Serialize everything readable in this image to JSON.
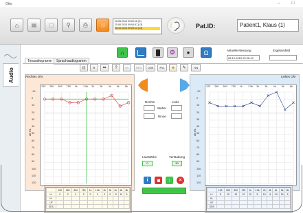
{
  "window": {
    "title": "Otto",
    "minimize": "–",
    "close": "□"
  },
  "sessions": [
    "25.06.2015 09:02:16 (S)",
    "25.06.2015 09:04:57 (13)",
    "08.10.2015 09:25:12 (13)"
  ],
  "patient": {
    "label": "Pat.ID:",
    "name": "Patient1, Klaus (1)"
  },
  "sidebar": {
    "audio": "Audio"
  },
  "tabs": [
    "Tonaudiogramm",
    "Sprachaudiogramm"
  ],
  "small_buttons": [
    "",
    "",
    "",
    "",
    "BC",
    "STG",
    "LGB",
    "PvL",
    "",
    "",
    "TIN"
  ],
  "measurement": {
    "aktuelle_label": "Aktuelle Messung",
    "aktuelle_value": "08.10.2015 09:25:12",
    "end_label": "Ergebnisfeld"
  },
  "right_ear": {
    "title": "Rechtes Ohr"
  },
  "left_ear": {
    "title": "Linkes Ohr"
  },
  "xaxis": [
    "125",
    "250",
    "500",
    "750",
    "1k",
    "1.5k",
    "2k",
    "3k",
    "4k",
    "6k",
    "8k"
  ],
  "yaxis": [
    "-10",
    "0",
    "10",
    "20",
    "30",
    "40",
    "50",
    "60",
    "70",
    "80",
    "90",
    "100",
    "110",
    "120"
  ],
  "ylabel": "dB HL",
  "center": {
    "rechts": "Rechts",
    "links": "Links",
    "weber": "Weber",
    "rinne": "Rinne",
    "lautstaerke": "Lautstärke",
    "lautstaerke_value": "0",
    "vertaeubung": "Vertäubung",
    "vertaeubung_value": "30"
  },
  "table_rows": [
    "LL",
    "KL",
    "UF",
    "SDS"
  ],
  "table_right_vals": [
    "0",
    "0",
    "0",
    "0",
    "0",
    "0",
    "0",
    "0",
    "-5",
    "10",
    "5"
  ],
  "table_left_vals": [
    "5",
    "10",
    "10",
    "10",
    "10",
    "5",
    "10",
    "-5",
    "-10",
    "15",
    "5"
  ],
  "chart_data": [
    {
      "type": "line",
      "title": "Rechtes Ohr",
      "x": [
        "125",
        "250",
        "500",
        "750",
        "1k",
        "1.5k",
        "2k",
        "3k",
        "4k",
        "6k",
        "8k"
      ],
      "series": [
        {
          "values": [
            0,
            0,
            0,
            5,
            5,
            0,
            0,
            0,
            -5,
            10,
            5
          ]
        }
      ],
      "ylim": [
        -10,
        120
      ],
      "ylabel": "dB HL"
    },
    {
      "type": "line",
      "title": "Linkes Ohr",
      "x": [
        "125",
        "250",
        "500",
        "750",
        "1k",
        "1.5k",
        "2k",
        "3k",
        "4k",
        "6k",
        "8k"
      ],
      "series": [
        {
          "values": [
            5,
            10,
            10,
            10,
            10,
            5,
            10,
            -5,
            -10,
            15,
            5
          ]
        }
      ],
      "ylim": [
        -10,
        120
      ],
      "ylabel": "dB HL"
    }
  ],
  "colors": {
    "right": "#d63a3a",
    "left": "#2c3f8c",
    "accent": "#f28a1e",
    "green": "#3fc44a"
  }
}
